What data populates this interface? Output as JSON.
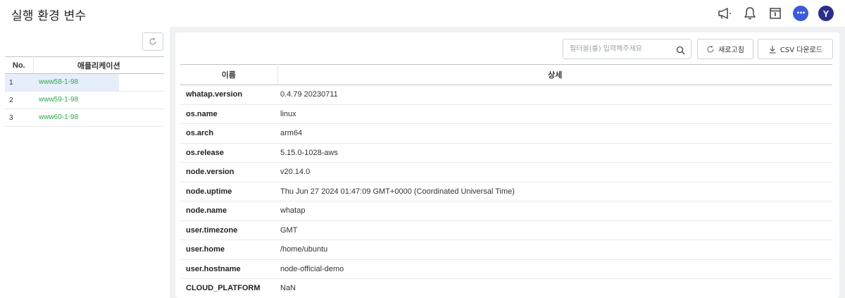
{
  "header": {
    "title": "실행 환경 변수",
    "icons": [
      "megaphone-icon",
      "bell-icon",
      "calendar-icon",
      "chat-icon"
    ],
    "avatar_letter": "Y",
    "chat_glyph": "•••"
  },
  "sidebar": {
    "columns": {
      "no": "No.",
      "app": "애플리케이션"
    },
    "rows": [
      {
        "no": "1",
        "name": "www58-1-98",
        "selected": true
      },
      {
        "no": "2",
        "name": "www59-1-98",
        "selected": false
      },
      {
        "no": "3",
        "name": "www60-1-98",
        "selected": false
      }
    ]
  },
  "toolbar": {
    "filter_placeholder": "필터을(를) 입력해주세요",
    "filter_value": "",
    "refresh_label": "새로고침",
    "csv_label": "CSV 다운로드"
  },
  "table": {
    "columns": {
      "name": "이름",
      "detail": "상세"
    },
    "rows": [
      {
        "key": "whatap.version",
        "value": "0.4.79 20230711"
      },
      {
        "key": "os.name",
        "value": "linux"
      },
      {
        "key": "os.arch",
        "value": "arm64"
      },
      {
        "key": "os.release",
        "value": "5.15.0-1028-aws"
      },
      {
        "key": "node.version",
        "value": "v20.14.0"
      },
      {
        "key": "node.uptime",
        "value": "Thu Jun 27 2024 01:47:09 GMT+0000 (Coordinated Universal Time)"
      },
      {
        "key": "node.name",
        "value": "whatap"
      },
      {
        "key": "user.timezone",
        "value": "GMT"
      },
      {
        "key": "user.home",
        "value": "/home/ubuntu"
      },
      {
        "key": "user.hostname",
        "value": "node-official-demo"
      },
      {
        "key": "CLOUD_PLATFORM",
        "value": "NaN"
      }
    ]
  },
  "colors": {
    "accent": "#3b5bdb",
    "avatar": "#2b2f8a",
    "app_link": "#2ea84a",
    "selected_row": "#e6eefb"
  }
}
